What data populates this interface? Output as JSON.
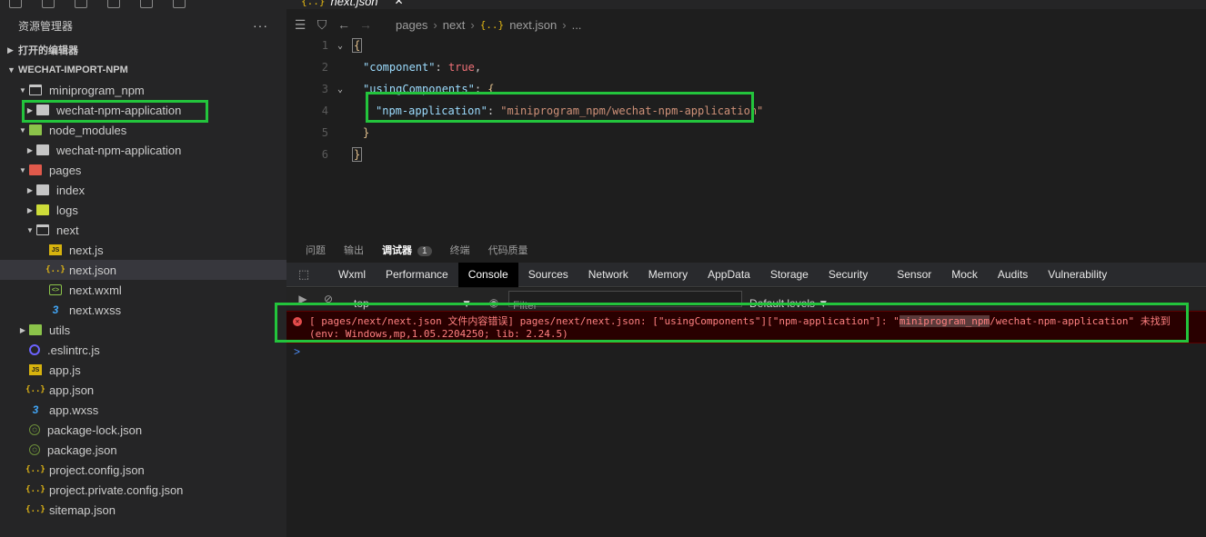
{
  "explorer": {
    "title": "资源管理器",
    "more": "···",
    "open_editors": "打开的编辑器",
    "project": "WECHAT-IMPORT-NPM",
    "tree": [
      {
        "label": "miniprogram_npm",
        "depth": 1,
        "chevron": "▼",
        "icon": "folder-open"
      },
      {
        "label": "wechat-npm-application",
        "depth": 2,
        "chevron": "▶",
        "icon": "folder"
      },
      {
        "label": "node_modules",
        "depth": 1,
        "chevron": "▼",
        "icon": "folder-node"
      },
      {
        "label": "wechat-npm-application",
        "depth": 2,
        "chevron": "▶",
        "icon": "folder"
      },
      {
        "label": "pages",
        "depth": 1,
        "chevron": "▼",
        "icon": "folder-pages"
      },
      {
        "label": "index",
        "depth": 2,
        "chevron": "▶",
        "icon": "folder"
      },
      {
        "label": "logs",
        "depth": 2,
        "chevron": "▶",
        "icon": "folder-logs"
      },
      {
        "label": "next",
        "depth": 2,
        "chevron": "▼",
        "icon": "folder-open"
      },
      {
        "label": "next.js",
        "depth": 3,
        "chevron": "",
        "icon": "js"
      },
      {
        "label": "next.json",
        "depth": 3,
        "chevron": "",
        "icon": "json",
        "selected": true
      },
      {
        "label": "next.wxml",
        "depth": 3,
        "chevron": "",
        "icon": "wxml"
      },
      {
        "label": "next.wxss",
        "depth": 3,
        "chevron": "",
        "icon": "wxss"
      },
      {
        "label": "utils",
        "depth": 1,
        "chevron": "▶",
        "icon": "folder-utils"
      },
      {
        "label": ".eslintrc.js",
        "depth": 1,
        "chevron": "",
        "icon": "eslint"
      },
      {
        "label": "app.js",
        "depth": 1,
        "chevron": "",
        "icon": "js"
      },
      {
        "label": "app.json",
        "depth": 1,
        "chevron": "",
        "icon": "json"
      },
      {
        "label": "app.wxss",
        "depth": 1,
        "chevron": "",
        "icon": "wxss"
      },
      {
        "label": "package-lock.json",
        "depth": 1,
        "chevron": "",
        "icon": "pkg"
      },
      {
        "label": "package.json",
        "depth": 1,
        "chevron": "",
        "icon": "pkg"
      },
      {
        "label": "project.config.json",
        "depth": 1,
        "chevron": "",
        "icon": "json"
      },
      {
        "label": "project.private.config.json",
        "depth": 1,
        "chevron": "",
        "icon": "json"
      },
      {
        "label": "sitemap.json",
        "depth": 1,
        "chevron": "",
        "icon": "json"
      }
    ]
  },
  "editor": {
    "tab_label": "next.json",
    "tab_icon": "{..}",
    "tab_close": "✕",
    "breadcrumb": [
      "pages",
      "next",
      "next.json",
      "..."
    ],
    "breadcrumb_json_icon": "{..}",
    "code": {
      "l1": "{",
      "l2_key": "\"component\"",
      "l2_val": "true",
      "l3_key": "\"usingComponents\"",
      "l3_brace": "{",
      "l4_key": "\"npm-application\"",
      "l4_val": "\"miniprogram_npm/wechat-npm-application\"",
      "l5": "}",
      "l6": "}",
      "line_numbers": [
        "1",
        "2",
        "3",
        "4",
        "5",
        "6"
      ]
    }
  },
  "panel": {
    "tabs": [
      "问题",
      "输出",
      "调试器",
      "终端",
      "代码质量"
    ],
    "active_tab": "调试器",
    "badge": "1"
  },
  "devtools": {
    "tabs": [
      "Wxml",
      "Performance",
      "Console",
      "Sources",
      "Network",
      "Memory",
      "AppData",
      "Storage",
      "Security",
      "Sensor",
      "Mock",
      "Audits",
      "Vulnerability"
    ],
    "active": "Console",
    "context": "top",
    "filter_placeholder": "Filter",
    "levels": "Default levels ▼"
  },
  "console": {
    "error_part1": "[ pages/next/next.json 文件内容错误] pages/next/next.json: [\"usingComponents\"][\"npm-application\"]: \"",
    "error_highlight": "miniprogram_npm",
    "error_part2": "/wechat-npm-application\" 未找到",
    "error_line2": "(env: Windows,mp,1.05.2204250; lib: 2.24.5)",
    "prompt": ">"
  },
  "colors": {
    "highlight_box": "#23c43c",
    "error_bg": "#290000",
    "error_text": "#ff8080"
  }
}
